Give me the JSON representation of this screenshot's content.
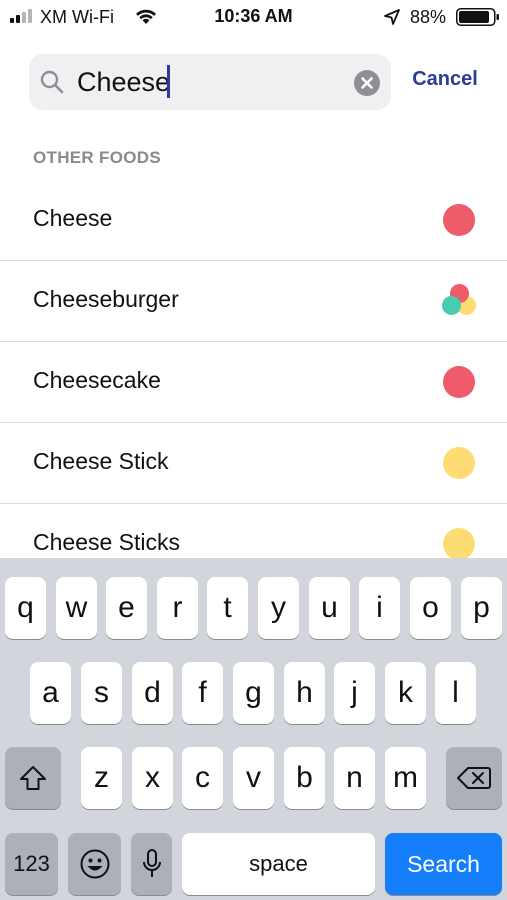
{
  "status_bar": {
    "carrier": "XM Wi-Fi",
    "time": "10:36 AM",
    "battery_percent": "88%"
  },
  "search": {
    "value": "Cheese",
    "cancel_label": "Cancel"
  },
  "results": {
    "section_title": "OTHER FOODS",
    "items": [
      {
        "label": "Cheese",
        "dot_colors": [
          "#ee5b6a"
        ]
      },
      {
        "label": "Cheeseburger",
        "dot_colors": [
          "#ee5b6a",
          "#49cbb2",
          "#fddc73"
        ]
      },
      {
        "label": "Cheesecake",
        "dot_colors": [
          "#ee5b6a"
        ]
      },
      {
        "label": "Cheese Stick",
        "dot_colors": [
          "#fddc73"
        ]
      },
      {
        "label": "Cheese Sticks",
        "dot_colors": [
          "#fddc73"
        ]
      }
    ]
  },
  "keyboard": {
    "row1": [
      "q",
      "w",
      "e",
      "r",
      "t",
      "y",
      "u",
      "i",
      "o",
      "p"
    ],
    "row2": [
      "a",
      "s",
      "d",
      "f",
      "g",
      "h",
      "j",
      "k",
      "l"
    ],
    "row3": [
      "z",
      "x",
      "c",
      "v",
      "b",
      "n",
      "m"
    ],
    "numbers_label": "123",
    "space_label": "space",
    "search_label": "Search",
    "shift_icon": "shift-icon",
    "delete_icon": "delete-icon",
    "emoji_icon": "emoji-icon",
    "mic_icon": "microphone-icon"
  }
}
